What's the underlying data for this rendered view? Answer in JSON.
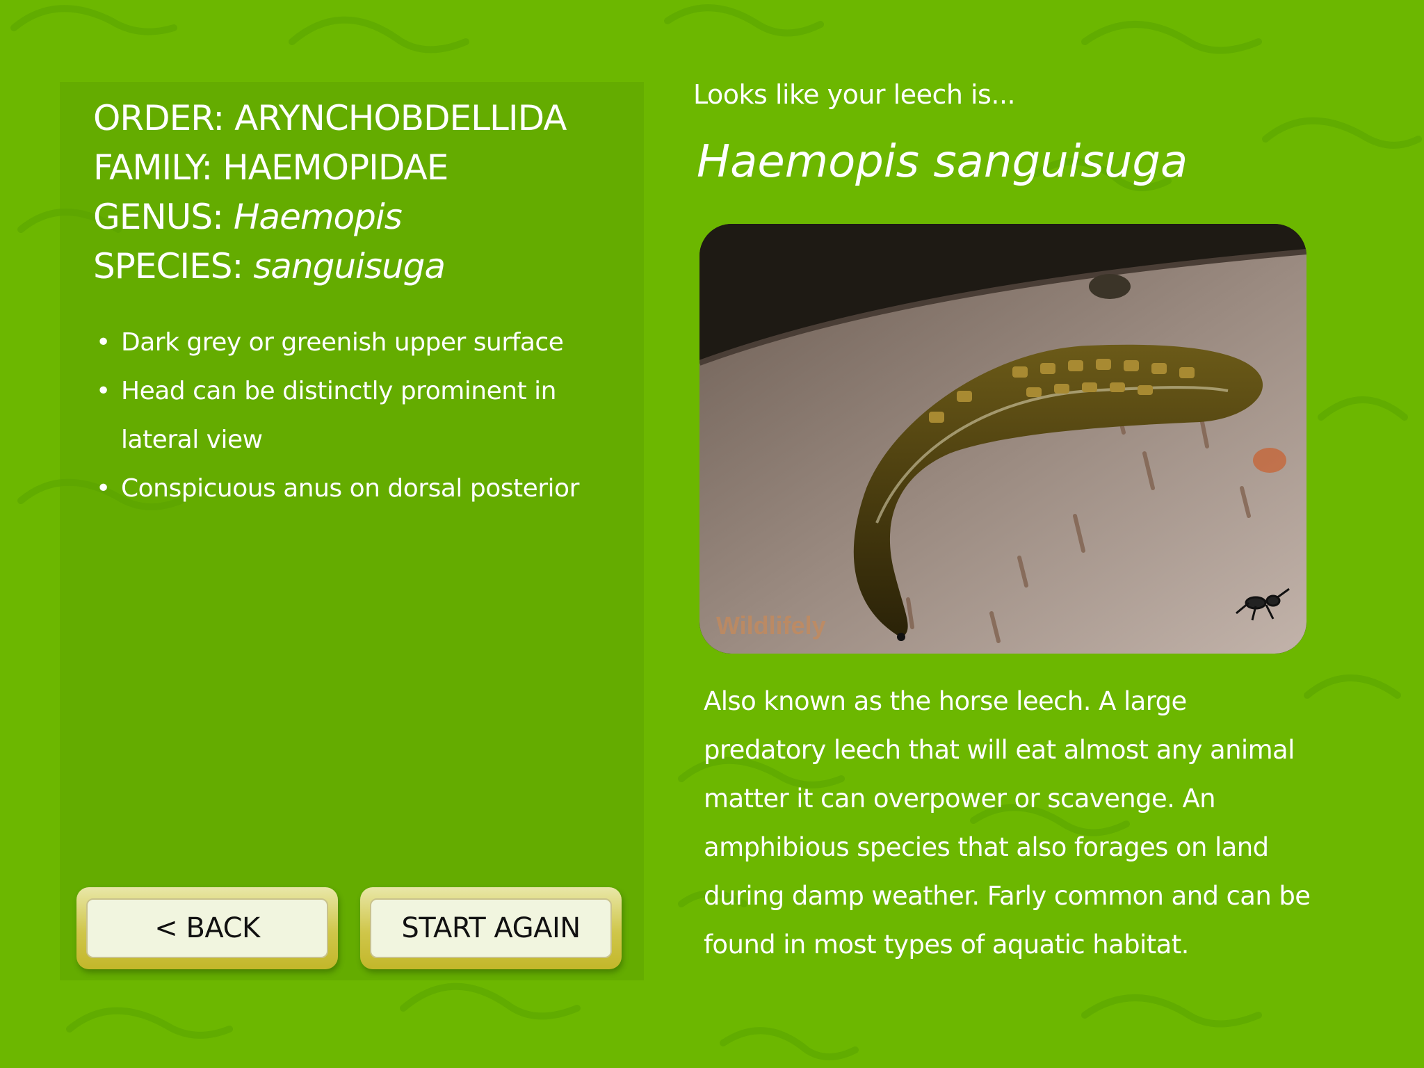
{
  "taxonomy": {
    "order_label": "ORDER:",
    "order_value": "ARYNCHOBDELLIDA",
    "family_label": "FAMILY:",
    "family_value": "HAEMOPIDAE",
    "genus_label": "GENUS:",
    "genus_value": "Haemopis",
    "species_label": "SPECIES:",
    "species_value": "sanguisuga"
  },
  "traits": [
    "Dark grey or greenish upper surface",
    "Head can be distinctly prominent in lateral view",
    "Conspicuous anus on dorsal posterior"
  ],
  "bullet": "•",
  "buttons": {
    "back": "< BACK",
    "start_again": "START AGAIN"
  },
  "result": {
    "intro": "Looks like your leech is...",
    "species_name": "Haemopis sanguisuga",
    "photo_watermark": "Wildlifely",
    "description": "Also known as the horse leech. A large predatory leech that will eat almost any animal matter it can overpower or scavenge. An amphibious species that also forages on land during damp weather. Farly common and can be found in most types of aquatic habitat."
  },
  "colors": {
    "background": "#6cb700",
    "panel": "#5aa000",
    "button_border": "#cfc64a",
    "button_face": "#f1f5df"
  }
}
